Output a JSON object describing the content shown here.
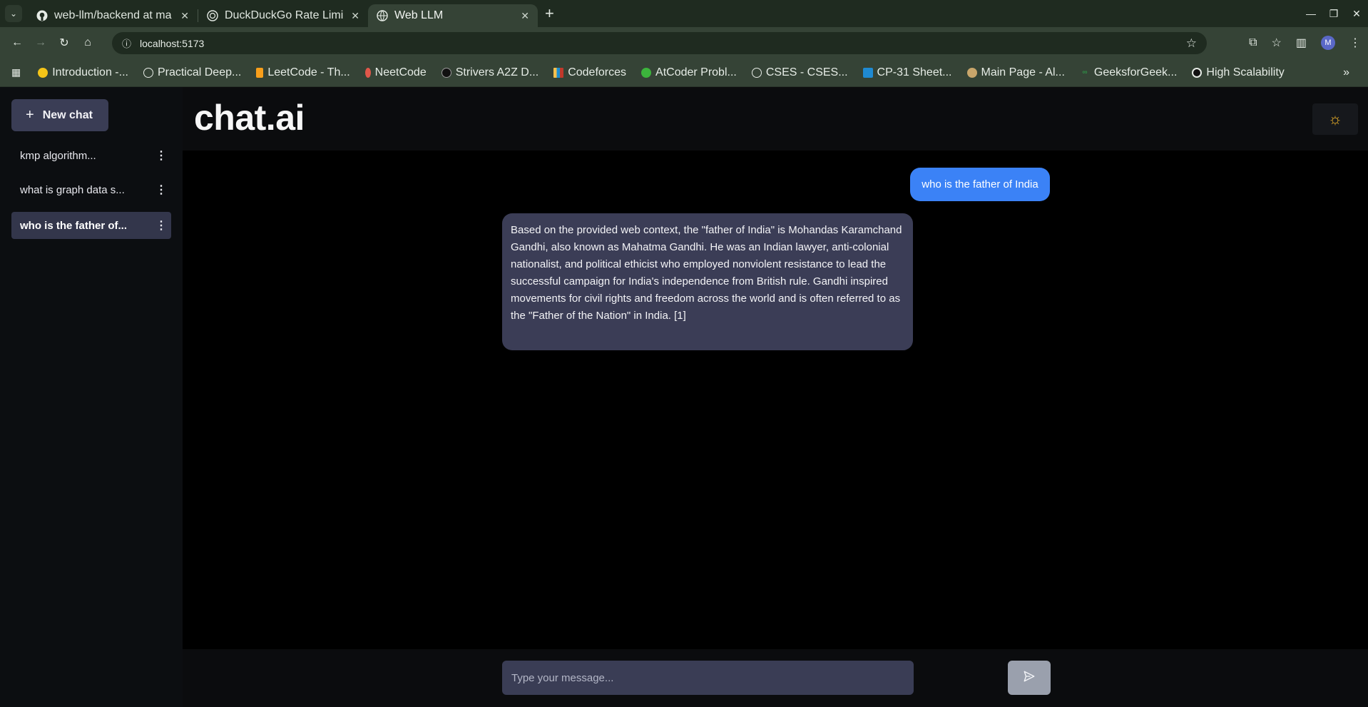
{
  "browser": {
    "tabs": [
      {
        "title": "web-llm/backend at ma",
        "icon": "github-icon"
      },
      {
        "title": "DuckDuckGo Rate Limi",
        "icon": "globe-icon"
      },
      {
        "title": "Web LLM",
        "icon": "globe-icon",
        "active": true
      }
    ],
    "url": "localhost:5173",
    "profile_initial": "M",
    "bookmarks": [
      {
        "label": "Introduction -...",
        "icon": "hugging-face-icon"
      },
      {
        "label": "Practical Deep...",
        "icon": "globe-icon"
      },
      {
        "label": "LeetCode - Th...",
        "icon": "leetcode-icon"
      },
      {
        "label": "NeetCode",
        "icon": "neetcode-icon"
      },
      {
        "label": "Strivers A2Z D...",
        "icon": "tuf-icon"
      },
      {
        "label": "Codeforces",
        "icon": "codeforces-icon"
      },
      {
        "label": "AtCoder Probl...",
        "icon": "atcoder-icon"
      },
      {
        "label": "CSES - CSES...",
        "icon": "globe-icon"
      },
      {
        "label": "CP-31 Sheet...",
        "icon": "cp31-icon"
      },
      {
        "label": "Main Page - Al...",
        "icon": "algorithmica-icon"
      },
      {
        "label": "GeeksforGeek...",
        "icon": "gfg-icon"
      },
      {
        "label": "High Scalability",
        "icon": "circle-icon"
      }
    ]
  },
  "sidebar": {
    "new_chat_label": "New chat",
    "conversations": [
      {
        "label": "kmp algorithm..."
      },
      {
        "label": "what is graph data s..."
      },
      {
        "label": "who is the father of...",
        "active": true
      }
    ]
  },
  "header": {
    "brand": "chat.ai",
    "theme_icon": "sun-icon"
  },
  "messages": {
    "user": "who is the father of India",
    "assistant": "Based on the provided web context, the \"father of India\" is Mohandas Karamchand Gandhi, also known as Mahatma Gandhi. He was an Indian lawyer, anti-colonial nationalist, and political ethicist who employed nonviolent resistance to lead the successful campaign for India's independence from British rule. Gandhi inspired movements for civil rights and freedom across the world and is often referred to as the \"Father of the Nation\" in India. [1]"
  },
  "composer": {
    "placeholder": "Type your message...",
    "send_icon": "send-icon"
  },
  "colors": {
    "user_bubble": "#3b82f6",
    "assistant_bubble": "#3b3d56",
    "sun": "#f0b429"
  }
}
